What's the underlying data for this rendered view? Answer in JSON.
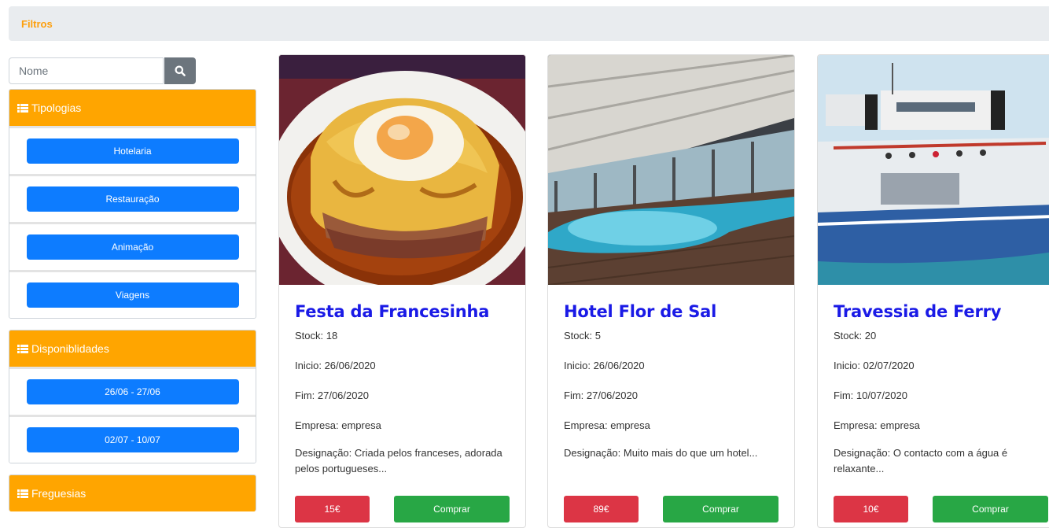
{
  "filters_bar": {
    "label": "Filtros"
  },
  "search": {
    "placeholder": "Nome"
  },
  "tipologias": {
    "title": "Tipologias",
    "items": [
      "Hotelaria",
      "Restauração",
      "Animação",
      "Viagens"
    ]
  },
  "disponibilidades": {
    "title": "Disponiblidades",
    "items": [
      "26/06 - 27/06",
      "02/07 - 10/07"
    ]
  },
  "freguesias": {
    "title": "Freguesias"
  },
  "cards": [
    {
      "title": "Festa da Francesinha",
      "stock": "Stock: 18",
      "inicio": "Inicio: 26/06/2020",
      "fim": "Fim: 27/06/2020",
      "empresa": "Empresa: empresa",
      "designacao": "Designação: Criada pelos franceses, adorada pelos portugueses...",
      "price": "15€",
      "buy": "Comprar"
    },
    {
      "title": "Hotel Flor de Sal",
      "stock": "Stock: 5",
      "inicio": "Inicio: 26/06/2020",
      "fim": "Fim: 27/06/2020",
      "empresa": "Empresa: empresa",
      "designacao": "Designação: Muito mais do que um hotel...",
      "price": "89€",
      "buy": "Comprar"
    },
    {
      "title": "Travessia de Ferry",
      "stock": "Stock: 20",
      "inicio": "Inicio: 02/07/2020",
      "fim": "Fim: 10/07/2020",
      "empresa": "Empresa: empresa",
      "designacao": "Designação: O contacto com a água é relaxante...",
      "price": "10€",
      "buy": "Comprar"
    }
  ],
  "colors": {
    "filters_label": "#fd9f0c",
    "panel_header": "#ffa500",
    "filter_button": "#0d7cff",
    "price_button": "#dc3545",
    "buy_button": "#28a745",
    "card_title": "#1a1ae6"
  },
  "icons": {
    "search": "search-icon",
    "panel": "list-icon"
  }
}
